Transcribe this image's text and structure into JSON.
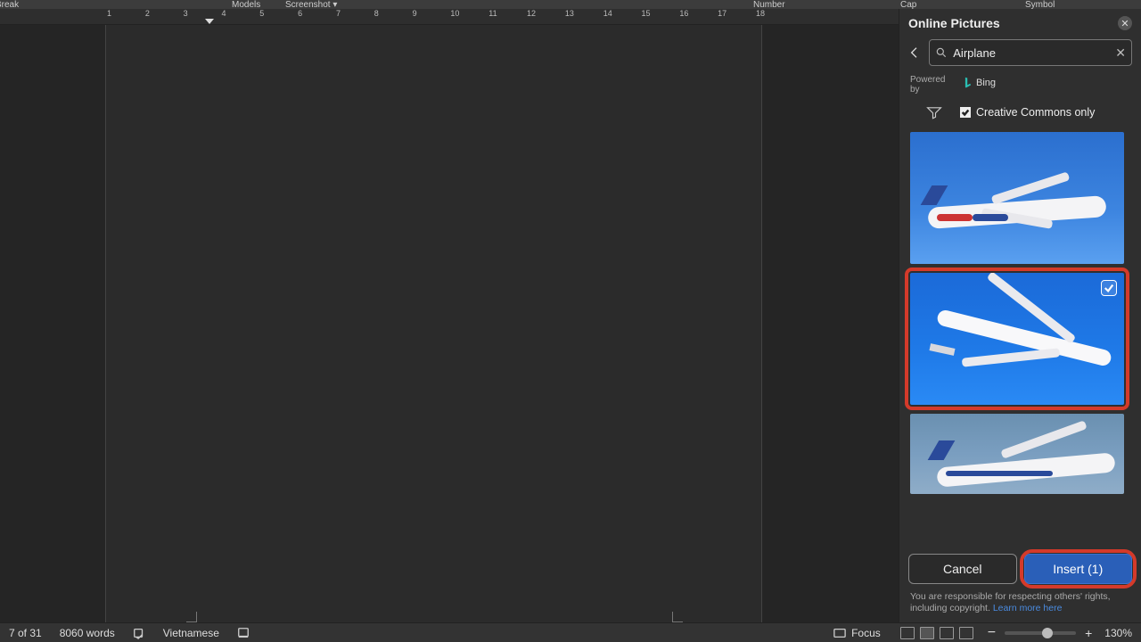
{
  "ribbon": {
    "break_label": "Break",
    "models_label": "Models",
    "screenshot_label": "Screenshot ▾",
    "cap_label": "Cap",
    "number_label": "Number",
    "symbol_label": "Symbol"
  },
  "ruler": {
    "ticks": [
      1,
      2,
      3,
      4,
      5,
      6,
      7,
      8,
      9,
      10,
      11,
      12,
      13,
      14,
      15,
      16,
      17,
      18
    ]
  },
  "sidepanel": {
    "title": "Online Pictures",
    "search_value": "Airplane",
    "powered_by_label": "Powered by",
    "bing_label": "Bing",
    "cc_only_label": "Creative Commons only",
    "results": [
      {
        "alt": "airplane-1",
        "selected": false
      },
      {
        "alt": "airplane-2",
        "selected": true
      },
      {
        "alt": "airplane-3",
        "selected": false
      }
    ],
    "selected_count": 1,
    "cancel_label": "Cancel",
    "insert_label": "Insert (1)",
    "footnote": "You are responsible for respecting others' rights, including copyright.",
    "learn_more_label": "Learn more here"
  },
  "statusbar": {
    "page_info": "7 of 31",
    "word_count": "8060 words",
    "language": "Vietnamese",
    "focus_label": "Focus",
    "zoom_pct": "130%"
  }
}
